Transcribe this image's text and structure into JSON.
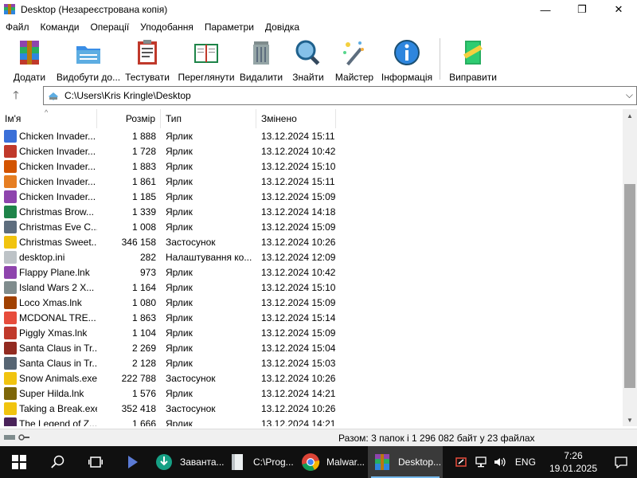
{
  "window": {
    "title": "Desktop (Незареєстрована копія)",
    "minimize": "—",
    "maximize": "❐",
    "close": "✕"
  },
  "menu": [
    "Файл",
    "Команди",
    "Операції",
    "Уподобання",
    "Параметри",
    "Довідка"
  ],
  "toolbar": [
    {
      "label": "Додати",
      "icon": "archive-add-icon"
    },
    {
      "label": "Видобути до...",
      "icon": "folder-extract-icon"
    },
    {
      "label": "Тестувати",
      "icon": "clipboard-test-icon"
    },
    {
      "label": "Переглянути",
      "icon": "book-view-icon"
    },
    {
      "label": "Видалити",
      "icon": "trash-can-icon"
    },
    {
      "label": "Знайти",
      "icon": "magnifier-icon"
    },
    {
      "label": "Майстер",
      "icon": "wizard-wand-icon"
    },
    {
      "label": "Інформація",
      "icon": "info-icon"
    },
    {
      "label": "Виправити",
      "icon": "repair-book-icon"
    }
  ],
  "address": {
    "path": "C:\\Users\\Kris Kringle\\Desktop"
  },
  "columns": {
    "name": "Ім'я",
    "size": "Розмір",
    "type": "Тип",
    "modified": "Змінено"
  },
  "files": [
    {
      "name": "Chicken Invader...",
      "size": "1 888",
      "type": "Ярлик",
      "modified": "13.12.2024 15:11",
      "icon": "chicken-invaders-icon",
      "color": "#3a6fd8"
    },
    {
      "name": "Chicken Invader...",
      "size": "1 728",
      "type": "Ярлик",
      "modified": "13.12.2024 10:42",
      "icon": "chicken-invaders-icon",
      "color": "#c0392b"
    },
    {
      "name": "Chicken Invader...",
      "size": "1 883",
      "type": "Ярлик",
      "modified": "13.12.2024 15:10",
      "icon": "chicken-invaders-icon",
      "color": "#d35400"
    },
    {
      "name": "Chicken Invader...",
      "size": "1 861",
      "type": "Ярлик",
      "modified": "13.12.2024 15:11",
      "icon": "chicken-invaders-icon",
      "color": "#e67e22"
    },
    {
      "name": "Chicken Invader...",
      "size": "1 185",
      "type": "Ярлик",
      "modified": "13.12.2024 15:09",
      "icon": "chicken-invaders-icon",
      "color": "#8e44ad"
    },
    {
      "name": "Christmas Brow...",
      "size": "1 339",
      "type": "Ярлик",
      "modified": "13.12.2024 14:18",
      "icon": "christmas-tree-icon",
      "color": "#1e8449"
    },
    {
      "name": "Christmas Eve C...",
      "size": "1 008",
      "type": "Ярлик",
      "modified": "13.12.2024 15:09",
      "icon": "christmas-eve-icon",
      "color": "#5d6d7e"
    },
    {
      "name": "Christmas Sweet...",
      "size": "346 158",
      "type": "Застосунок",
      "modified": "13.12.2024 10:26",
      "icon": "application-icon",
      "color": "#f1c40f"
    },
    {
      "name": "desktop.ini",
      "size": "282",
      "type": "Налаштування ко...",
      "modified": "13.12.2024 12:09",
      "icon": "settings-file-icon",
      "color": "#bdc3c7"
    },
    {
      "name": "Flappy Plane.lnk",
      "size": "973",
      "type": "Ярлик",
      "modified": "13.12.2024 10:42",
      "icon": "flappy-plane-icon",
      "color": "#8e44ad"
    },
    {
      "name": "Island Wars 2 X...",
      "size": "1 164",
      "type": "Ярлик",
      "modified": "13.12.2024 15:10",
      "icon": "island-wars-icon",
      "color": "#7f8c8d"
    },
    {
      "name": "Loco Xmas.lnk",
      "size": "1 080",
      "type": "Ярлик",
      "modified": "13.12.2024 15:09",
      "icon": "loco-xmas-icon",
      "color": "#a04000"
    },
    {
      "name": "MCDONAL TRE...",
      "size": "1 863",
      "type": "Ярлик",
      "modified": "13.12.2024 15:14",
      "icon": "mcdonald-icon",
      "color": "#e74c3c"
    },
    {
      "name": "Piggly Xmas.lnk",
      "size": "1 104",
      "type": "Ярлик",
      "modified": "13.12.2024 15:09",
      "icon": "piggly-xmas-icon",
      "color": "#c0392b"
    },
    {
      "name": "Santa Claus in Tr...",
      "size": "2 269",
      "type": "Ярлик",
      "modified": "13.12.2024 15:04",
      "icon": "santa-claus-icon",
      "color": "#922b21"
    },
    {
      "name": "Santa Claus in Tr...",
      "size": "2 128",
      "type": "Ярлик",
      "modified": "13.12.2024 15:03",
      "icon": "santa-claus-icon",
      "color": "#566573"
    },
    {
      "name": "Snow Animals.exe",
      "size": "222 788",
      "type": "Застосунок",
      "modified": "13.12.2024 10:26",
      "icon": "application-icon",
      "color": "#f1c40f"
    },
    {
      "name": "Super Hilda.lnk",
      "size": "1 576",
      "type": "Ярлик",
      "modified": "13.12.2024 14:21",
      "icon": "super-hilda-icon",
      "color": "#7d6608"
    },
    {
      "name": "Taking a Break.exe",
      "size": "352 418",
      "type": "Застосунок",
      "modified": "13.12.2024 10:26",
      "icon": "application-icon",
      "color": "#f1c40f"
    },
    {
      "name": "The Legend of Z...",
      "size": "1 666",
      "type": "Ярлик",
      "modified": "13.12.2024 14:21",
      "icon": "legend-icon",
      "color": "#4a235a"
    }
  ],
  "status": {
    "text": "Разом: 3 папок і 1 296 082 байт у 23 файлах"
  },
  "taskbar": {
    "apps": [
      {
        "label": "Заванта...",
        "icon": "download-app-icon"
      },
      {
        "label": "C:\\Prog...",
        "icon": "file-explorer-icon"
      },
      {
        "label": "Malwar...",
        "icon": "chrome-icon"
      },
      {
        "label": "Desktop...",
        "icon": "winrar-icon"
      }
    ],
    "language": "ENG",
    "time": "7:26",
    "date": "19.01.2025"
  }
}
